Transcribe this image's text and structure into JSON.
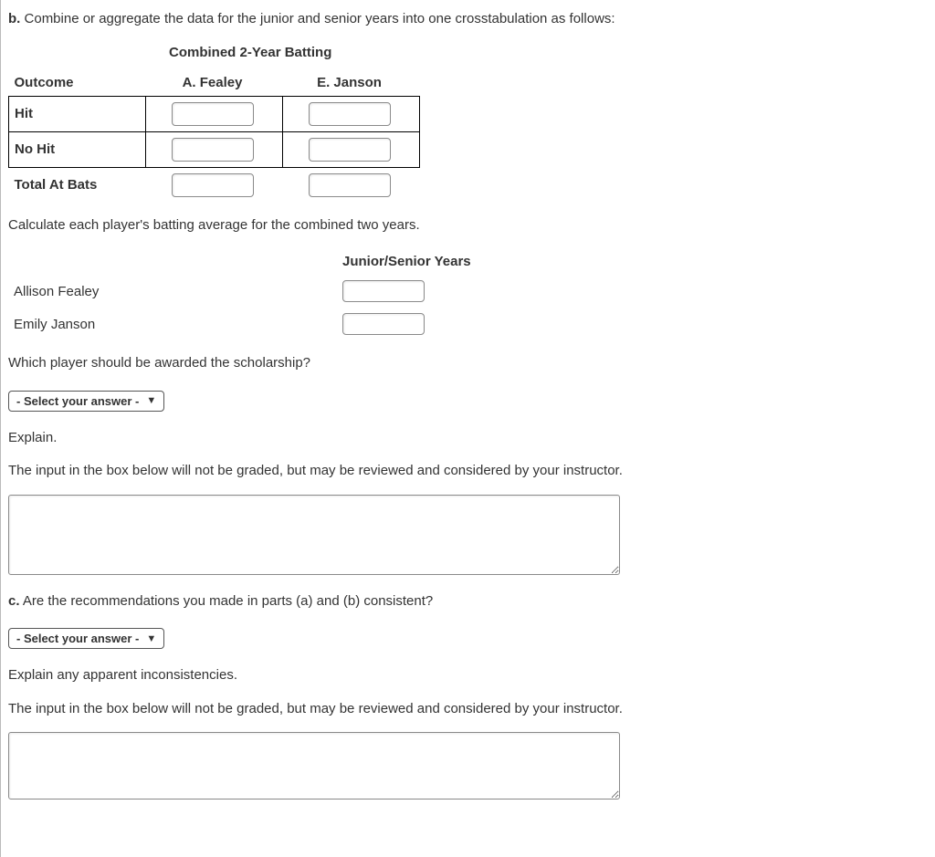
{
  "partB": {
    "label": "b.",
    "intro": "Combine or aggregate the data for the junior and senior years into one crosstabulation as follows:",
    "tableTitle": "Combined 2-Year Batting",
    "headers": {
      "outcome": "Outcome",
      "player1": "A. Fealey",
      "player2": "E. Janson"
    },
    "rows": {
      "hit": "Hit",
      "nohit": "No Hit",
      "total": "Total At Bats"
    },
    "calcPrompt": "Calculate each player's batting average for the combined two years.",
    "avgTitle": "Junior/Senior Years",
    "players": {
      "p1": "Allison Fealey",
      "p2": "Emily Janson"
    },
    "scholarshipQ": "Which player should be awarded the scholarship?",
    "selectPlaceholder": "- Select your answer -",
    "explainLabel": "Explain.",
    "notGraded": "The input in the box below will not be graded, but may be reviewed and considered by your instructor."
  },
  "partC": {
    "label": "c.",
    "question": "Are the recommendations you made in parts (a) and (b) consistent?",
    "selectPlaceholder": "- Select your answer -",
    "explainLabel": "Explain any apparent inconsistencies.",
    "notGraded": "The input in the box below will not be graded, but may be reviewed and considered by your instructor."
  }
}
